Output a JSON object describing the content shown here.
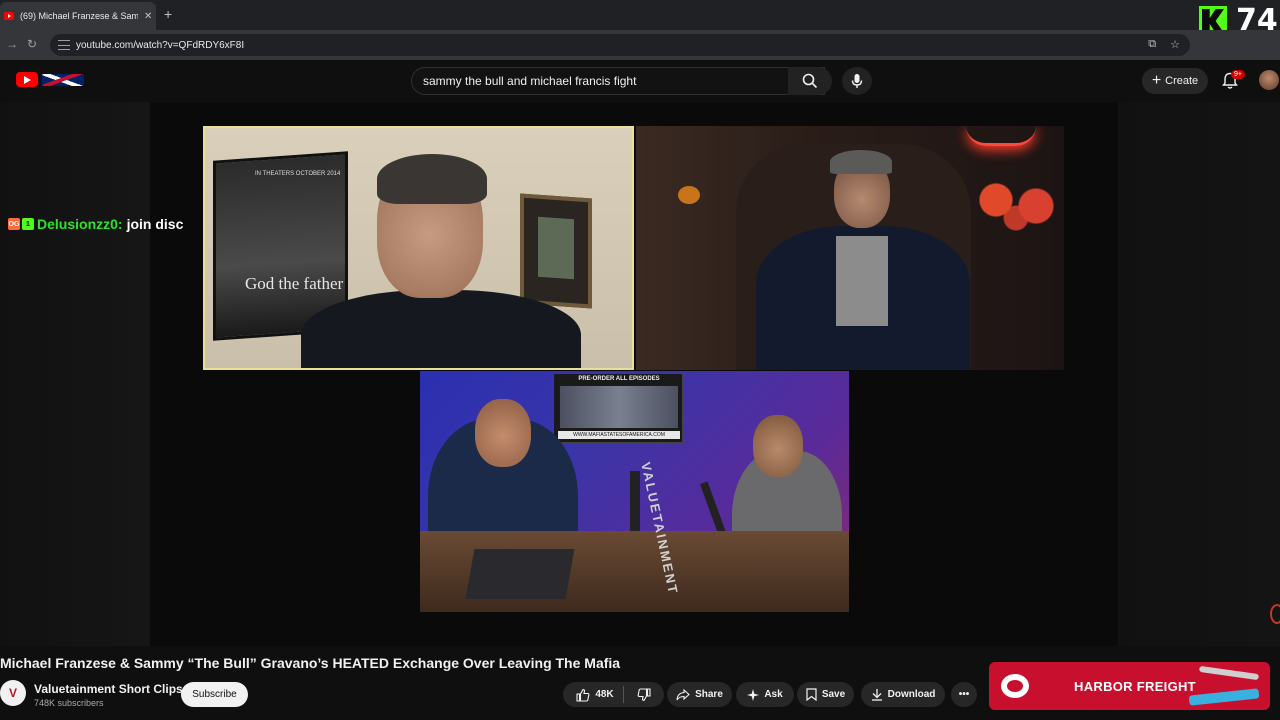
{
  "browser": {
    "tab_title": "(69) Michael Franzese & Samm",
    "url": "youtube.com/watch?v=QFdRDY6xF8I"
  },
  "overlay": {
    "viewer_count": "74",
    "chat_badge_og": "OG",
    "chat_badge_sub": "1",
    "chat_user": "Delusionzz0:",
    "chat_message": "join disc"
  },
  "youtube": {
    "search_query": "sammy the bull and michael francis fight",
    "create_label": "Create",
    "notifications_badge": "9+"
  },
  "video_content": {
    "poster_top": "IN THEATERS OCTOBER 2014",
    "poster_title": "God the father",
    "screen_title": "PRE-ORDER ALL EPISODES",
    "screen_url": "WWW.MAFIASTATESOFAMERICA.COM",
    "sign_text": "VALUETAINMENT"
  },
  "video": {
    "title": "Michael Franzese & Sammy “The Bull” Gravano’s HEATED Exchange Over Leaving The Mafia",
    "channel_name": "Valuetainment Short Clips",
    "subscribers": "748K subscribers",
    "subscribe_label": "Subscribe",
    "likes": "48K",
    "share_label": "Share",
    "ask_label": "Ask",
    "save_label": "Save",
    "download_label": "Download"
  },
  "ad": {
    "brand": "HARBOR FREIGHT"
  }
}
